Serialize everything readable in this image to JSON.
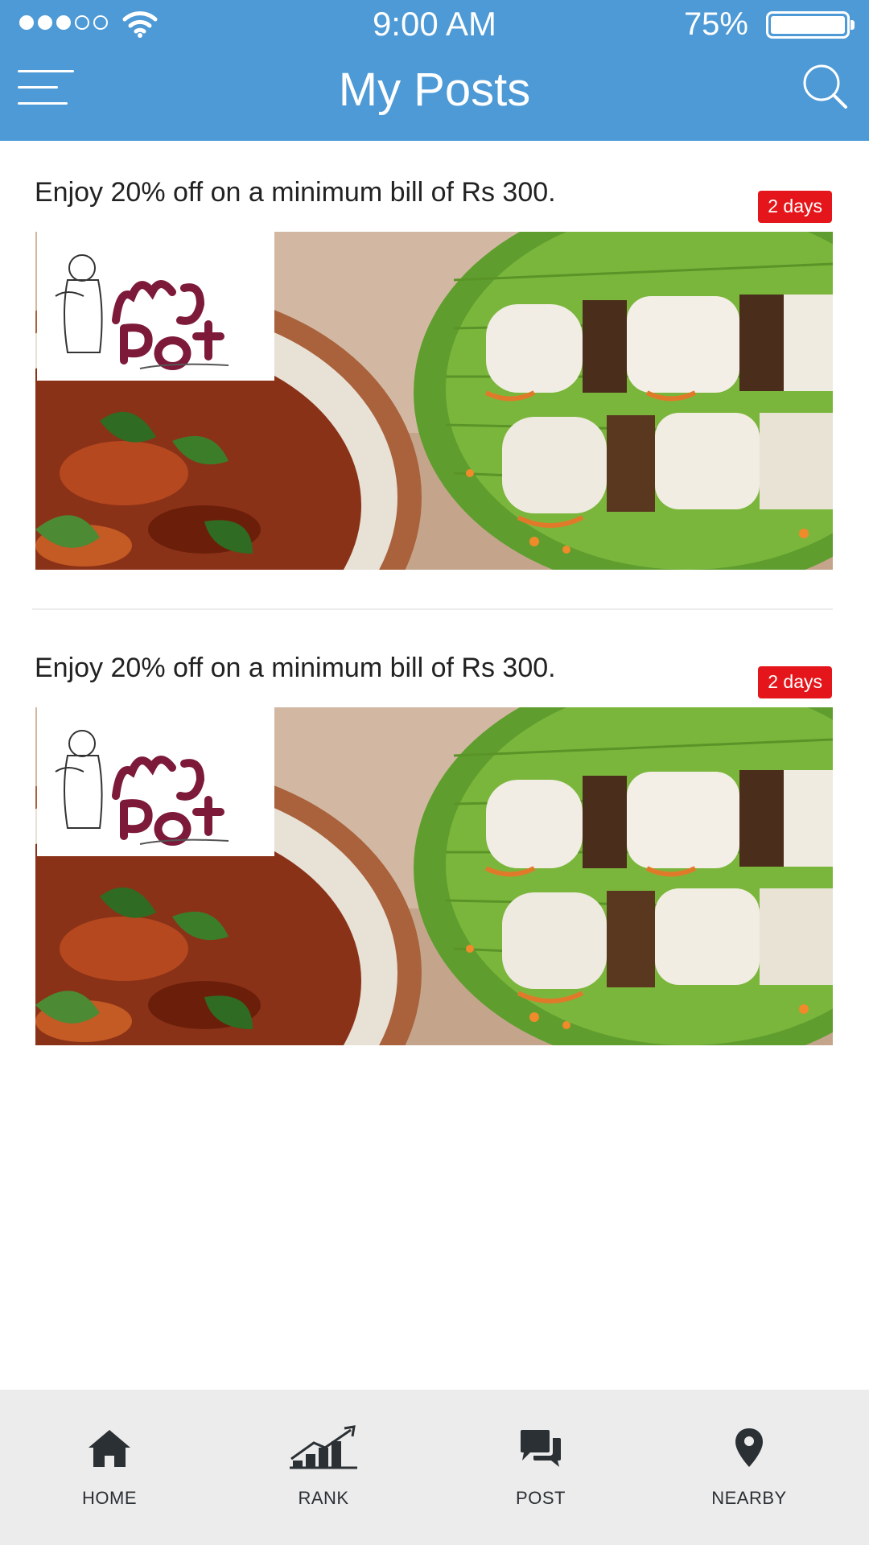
{
  "status_bar": {
    "time": "9:00 AM",
    "battery": "75%",
    "battery_level": 1.0,
    "signal_bars_filled": 3,
    "signal_bars_total": 5
  },
  "header": {
    "title": "My Posts",
    "menu_icon": "hamburger-menu-icon",
    "search_icon": "search-icon"
  },
  "posts": [
    {
      "text": "Enjoy 20% off on a minimum bill of Rs 300.",
      "badge": "2 days",
      "image": "mud-pot-restaurant-food-banner"
    },
    {
      "text": "Enjoy 20% off on a minimum bill of Rs 300.",
      "badge": "2 days",
      "image": "mud-pot-restaurant-food-banner"
    }
  ],
  "tabs": [
    {
      "label": "HOME",
      "icon": "home-icon"
    },
    {
      "label": "RANK",
      "icon": "rank-chart-icon"
    },
    {
      "label": "POST",
      "icon": "chat-bubbles-icon"
    },
    {
      "label": "NEARBY",
      "icon": "map-pin-icon"
    }
  ],
  "colors": {
    "header": "#4d9ad6",
    "badge": "#e5161b",
    "tabbar": "#ececec",
    "tab_icon": "#2b3035"
  }
}
